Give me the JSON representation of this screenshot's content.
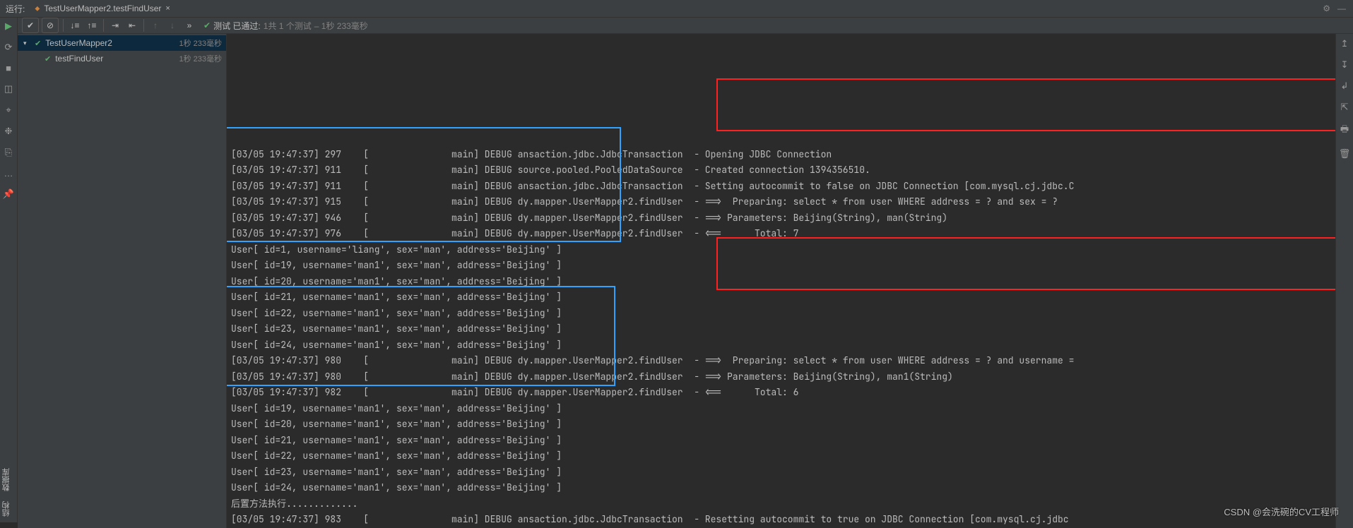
{
  "topbar": {
    "runlabel": "运行:",
    "tab": "TestUserMapper2.testFindUser",
    "close": "×"
  },
  "toolbar": {
    "status_prefix": "测试 已通过:",
    "status_count": "1共 1 个测试",
    "status_time": "– 1秒 233毫秒"
  },
  "tree": {
    "root": {
      "name": "TestUserMapper2",
      "time": "1秒 233毫秒"
    },
    "child": {
      "name": "testFindUser",
      "time": "1秒 233毫秒"
    }
  },
  "console_lines": [
    "[03/05 19:47:37] 297    [               main] DEBUG ansaction.jdbc.JdbcTransaction  - Opening JDBC Connection",
    "[03/05 19:47:37] 911    [               main] DEBUG source.pooled.PooledDataSource  - Created connection 1394356510.",
    "[03/05 19:47:37] 911    [               main] DEBUG ansaction.jdbc.JdbcTransaction  - Setting autocommit to false on JDBC Connection [com.mysql.cj.jdbc.C",
    "[03/05 19:47:37] 915    [               main] DEBUG dy.mapper.UserMapper2.findUser  - ==>  Preparing: select * from user WHERE address = ? and sex = ?",
    "[03/05 19:47:37] 946    [               main] DEBUG dy.mapper.UserMapper2.findUser  - ==> Parameters: Beijing(String), man(String)",
    "[03/05 19:47:37] 976    [               main] DEBUG dy.mapper.UserMapper2.findUser  - <==      Total: 7",
    "User[ id=1, username='liang', sex='man', address='Beijing' ]",
    "User[ id=19, username='man1', sex='man', address='Beijing' ]",
    "User[ id=20, username='man1', sex='man', address='Beijing' ]",
    "User[ id=21, username='man1', sex='man', address='Beijing' ]",
    "User[ id=22, username='man1', sex='man', address='Beijing' ]",
    "User[ id=23, username='man1', sex='man', address='Beijing' ]",
    "User[ id=24, username='man1', sex='man', address='Beijing' ]",
    "[03/05 19:47:37] 980    [               main] DEBUG dy.mapper.UserMapper2.findUser  - ==>  Preparing: select * from user WHERE address = ? and username =",
    "[03/05 19:47:37] 980    [               main] DEBUG dy.mapper.UserMapper2.findUser  - ==> Parameters: Beijing(String), man1(String)",
    "[03/05 19:47:37] 982    [               main] DEBUG dy.mapper.UserMapper2.findUser  - <==      Total: 6",
    "User[ id=19, username='man1', sex='man', address='Beijing' ]",
    "User[ id=20, username='man1', sex='man', address='Beijing' ]",
    "User[ id=21, username='man1', sex='man', address='Beijing' ]",
    "User[ id=22, username='man1', sex='man', address='Beijing' ]",
    "User[ id=23, username='man1', sex='man', address='Beijing' ]",
    "User[ id=24, username='man1', sex='man', address='Beijing' ]",
    "后置方法执行.............",
    "[03/05 19:47:37] 983    [               main] DEBUG ansaction.jdbc.JdbcTransaction  - Resetting autocommit to true on JDBC Connection [com.mysql.cj.jdbc"
  ],
  "leftvert": {
    "struct": "结构",
    "data": "数据库"
  },
  "watermark": "CSDN @会洗碗的CV工程师"
}
